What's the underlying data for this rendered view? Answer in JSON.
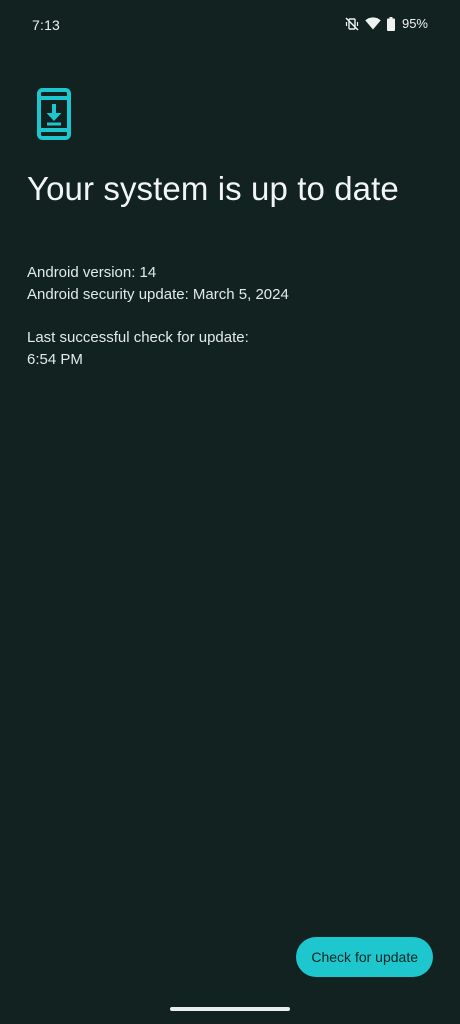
{
  "status_bar": {
    "time": "7:13",
    "battery_percent": "95%",
    "icons": [
      "vibrate-off-icon",
      "wifi-icon",
      "battery-icon"
    ]
  },
  "page": {
    "icon": "system-update-icon",
    "title": "Your system is up to date",
    "android_version": "Android version: 14",
    "security_update": "Android security update: March 5, 2024",
    "last_check_label": "Last successful check for update:",
    "last_check_time": "6:54 PM"
  },
  "actions": {
    "check_button_label": "Check for update"
  },
  "colors": {
    "background": "#112220",
    "accent": "#1ec6cd",
    "text": "#e6efed"
  }
}
